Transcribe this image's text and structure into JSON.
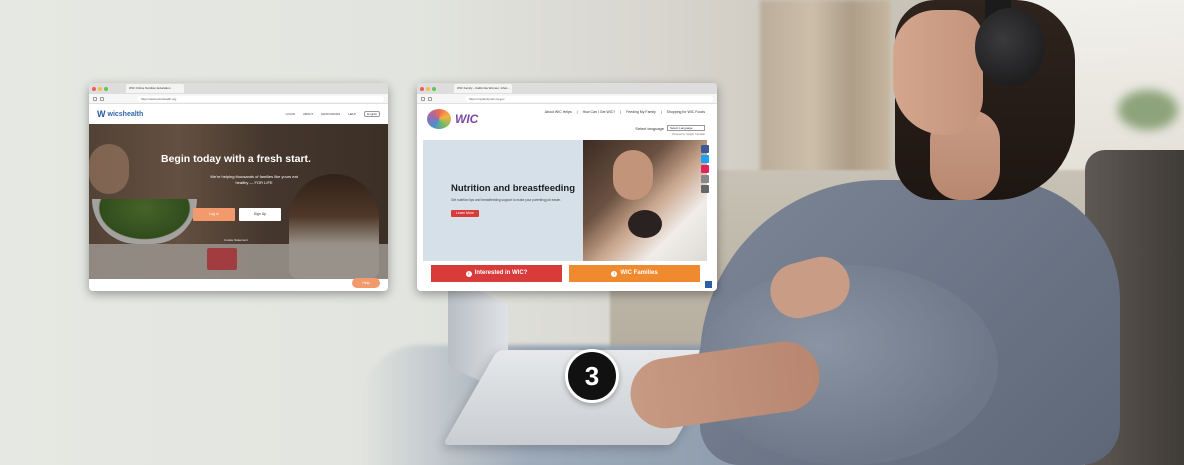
{
  "windows": [
    {
      "tab_title": "WIC Online Nutrition Education",
      "url": "https://www.wicshealth.org",
      "logo": "wicshealth",
      "nav_links": [
        "LOGIN",
        "ABOUT",
        "RESOURCES",
        "HELP"
      ],
      "lang": "English",
      "hero_title": "Begin today with a fresh start.",
      "hero_subtitle": "We're helping thousands of families like yours eat healthy — FOR LIFE",
      "login_label": "Log in",
      "signup_label": "Sign Up",
      "cookie_text": "Cookie Statement",
      "help_label": "Help"
    },
    {
      "tab_title": "WIC Family - California Women, Infan...",
      "url": "https://myfamily.wic.ca.gov",
      "logo_wic": "WIC",
      "nav_links": [
        "About WIC Helps",
        "How Can I Get WIC?",
        "Feeding My Family",
        "Shopping for WIC Foods"
      ],
      "language_label": "Select language",
      "language_value": "Select Language",
      "translate_text": "Powered by Google Translate",
      "hero_title": "Nutrition and breastfeeding",
      "hero_text": "Get nutrition tips and breastfeeding support to make your parenting job easier.",
      "learn_more": "Learn More",
      "btn_interested": "Interested in WIC?",
      "btn_families": "WIC Families"
    }
  ],
  "step_number": "3",
  "colors": {
    "accent_orange": "#f29a6b",
    "wic_red": "#d93a3a",
    "wic_orange": "#ef8a2f",
    "badge": "#111111"
  }
}
